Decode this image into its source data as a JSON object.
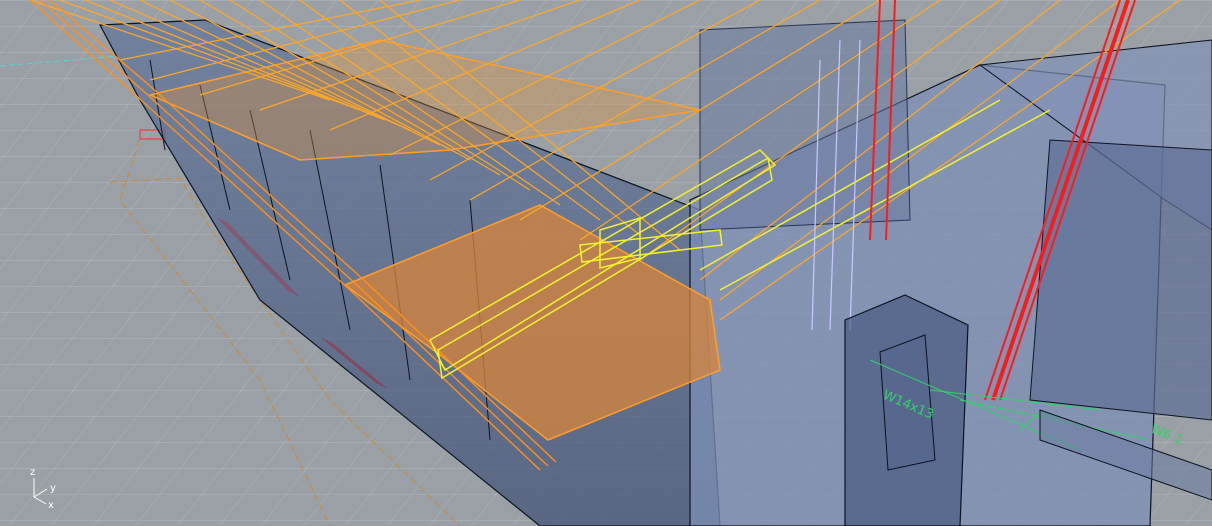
{
  "viewport": {
    "name": "Perspective",
    "background_color": "#9aa0a5",
    "grid_color": "#b5babe",
    "selection_color": "#ffa726",
    "highlight_color": "#f2f22a",
    "column_color": "#ff1a1a"
  },
  "annotations": {
    "beam_label": "W14x13",
    "dim_label": "W6 1"
  },
  "axis_widget": {
    "z_label": "z",
    "y_label": "y",
    "x_label": "x"
  }
}
